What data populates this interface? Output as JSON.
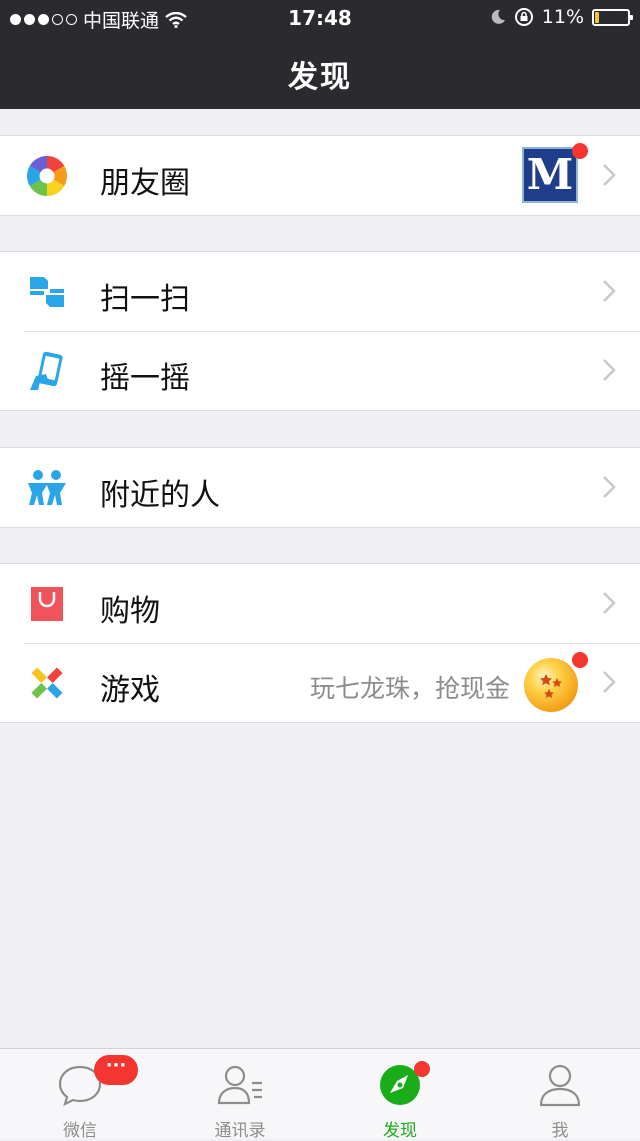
{
  "status_bar": {
    "carrier": "中国联通",
    "time": "17:48",
    "battery": "11%",
    "battery_level": 0.11
  },
  "nav": {
    "title": "发现"
  },
  "groups": [
    {
      "rows": [
        {
          "label": "朋友圈",
          "icon": "moments-aperture-icon",
          "thumb_text": "M"
        }
      ]
    },
    {
      "rows": [
        {
          "label": "扫一扫",
          "icon": "scan-icon"
        },
        {
          "label": "摇一摇",
          "icon": "shake-phone-icon"
        }
      ]
    },
    {
      "rows": [
        {
          "label": "附近的人",
          "icon": "people-nearby-icon"
        }
      ]
    },
    {
      "rows": [
        {
          "label": "购物",
          "icon": "shopping-bag-icon"
        },
        {
          "label": "游戏",
          "icon": "games-icon",
          "subtitle": "玩七龙珠，抢现金"
        }
      ]
    }
  ],
  "tabbar": {
    "tabs": [
      {
        "label": "微信",
        "icon": "chat-bubble-icon",
        "badge": "···"
      },
      {
        "label": "通讯录",
        "icon": "contacts-icon"
      },
      {
        "label": "发现",
        "icon": "compass-icon",
        "active": true
      },
      {
        "label": "我",
        "icon": "person-icon"
      }
    ]
  },
  "colors": {
    "nav_bg": "#2b2b2f",
    "accent_green": "#1aad19",
    "badge_red": "#f43530",
    "background": "#efeff4"
  }
}
